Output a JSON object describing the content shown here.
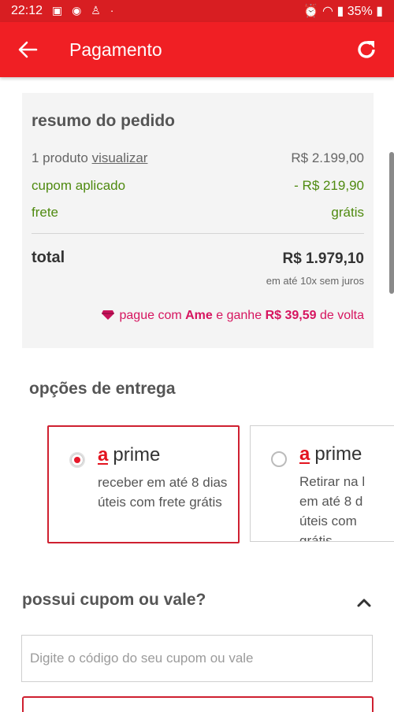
{
  "status_bar": {
    "time": "22:12",
    "notification_icons": [
      "image-icon",
      "messenger-icon",
      "app-icon",
      "dot-icon"
    ],
    "battery": "35%"
  },
  "app_bar": {
    "title": "Pagamento",
    "background": "#f01f24"
  },
  "summary": {
    "heading": "resumo do pedido",
    "product_count": "1 produto",
    "view_link": "visualizar",
    "product_price": "R$ 2.199,00",
    "coupon_label": "cupom aplicado",
    "coupon_value": "- R$ 219,90",
    "shipping_label": "frete",
    "shipping_value": "grátis",
    "total_label": "total",
    "total_value": "R$ 1.979,10",
    "installments": "em até 10x sem juros",
    "ame_prefix": "pague com",
    "ame_brand": "Ame",
    "ame_middle": "e ganhe",
    "ame_amount": "R$ 39,59",
    "ame_suffix": "de volta"
  },
  "delivery": {
    "title": "opções de entrega",
    "options": [
      {
        "logo_letter": "a",
        "brand": "prime",
        "description": "receber em até 8 dias úteis com frete grátis",
        "selected": true
      },
      {
        "logo_letter": "a",
        "brand": "prime",
        "description_lines": [
          "Retirar na l",
          "em até 8 d",
          "úteis com",
          "grátis"
        ],
        "selected": false
      }
    ]
  },
  "coupon": {
    "title": "possui cupom ou vale?",
    "placeholder": "Digite o código do seu cupom ou vale"
  },
  "colors": {
    "accent": "#e3141f",
    "ame": "#d6155f",
    "green": "#4f8a10"
  }
}
